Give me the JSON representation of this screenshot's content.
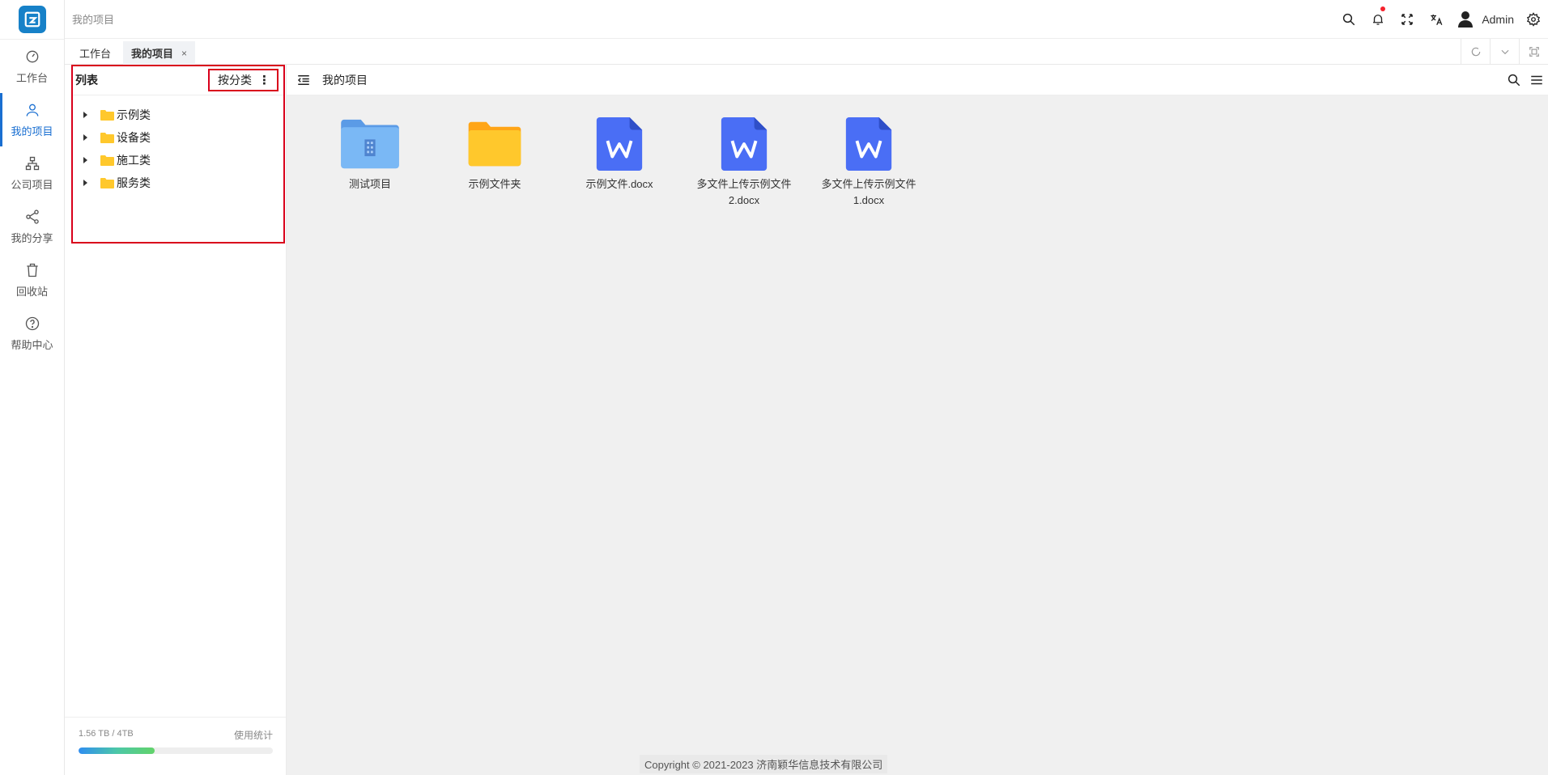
{
  "rail": {
    "items": [
      {
        "label": "工作台",
        "icon": "dashboard-icon"
      },
      {
        "label": "我的项目",
        "icon": "user-icon"
      },
      {
        "label": "公司项目",
        "icon": "org-chart-icon"
      },
      {
        "label": "我的分享",
        "icon": "share-icon"
      },
      {
        "label": "回收站",
        "icon": "trash-icon"
      },
      {
        "label": "帮助中心",
        "icon": "help-icon"
      }
    ],
    "active": "我的项目"
  },
  "header": {
    "breadcrumb": "我的项目",
    "user_name": "Admin",
    "notification_dot_color": "#f5222d"
  },
  "tabs": [
    {
      "label": "工作台"
    },
    {
      "label": "我的项目",
      "close": "×"
    }
  ],
  "panel": {
    "title": "列表",
    "classify_label": "按分类",
    "kebab": "⋮",
    "tree": [
      {
        "label": "示例类"
      },
      {
        "label": "设备类"
      },
      {
        "label": "施工类"
      },
      {
        "label": "服务类"
      }
    ],
    "storage": {
      "used_text": "1.56 TB / 4TB",
      "stats_label": "使用统计",
      "used_fraction": 0.39
    }
  },
  "main": {
    "title": "我的项目",
    "files": [
      {
        "name": "测试项目",
        "kind": "project-folder"
      },
      {
        "name": "示例文件夹",
        "kind": "folder"
      },
      {
        "name": "示例文件.docx",
        "kind": "word"
      },
      {
        "name": "多文件上传示例文件2.docx",
        "kind": "word"
      },
      {
        "name": "多文件上传示例文件1.docx",
        "kind": "word"
      }
    ]
  },
  "footer": {
    "copyright": "Copyright © 2021-2023 济南颖华信息技术有限公司"
  },
  "colors": {
    "accent": "#1a6fd1",
    "highlight_border": "#d9001b",
    "word_icon": "#4a6ef5",
    "folder_yellow": "#ffc82c",
    "project_folder_blue": "#7ab8f5"
  }
}
